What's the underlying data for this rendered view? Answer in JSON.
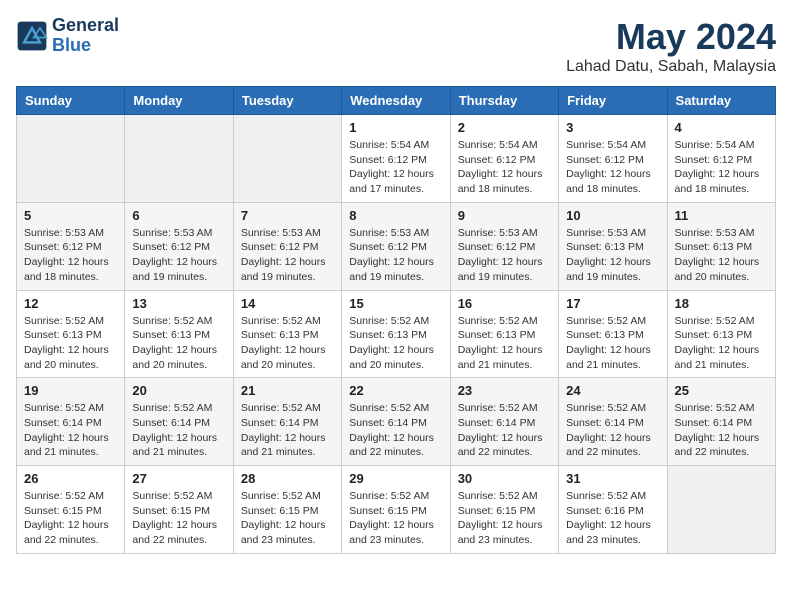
{
  "logo": {
    "line1": "General",
    "line2": "Blue"
  },
  "title": "May 2024",
  "subtitle": "Lahad Datu, Sabah, Malaysia",
  "days_header": [
    "Sunday",
    "Monday",
    "Tuesday",
    "Wednesday",
    "Thursday",
    "Friday",
    "Saturday"
  ],
  "weeks": [
    [
      {
        "day": "",
        "info": ""
      },
      {
        "day": "",
        "info": ""
      },
      {
        "day": "",
        "info": ""
      },
      {
        "day": "1",
        "info": "Sunrise: 5:54 AM\nSunset: 6:12 PM\nDaylight: 12 hours\nand 17 minutes."
      },
      {
        "day": "2",
        "info": "Sunrise: 5:54 AM\nSunset: 6:12 PM\nDaylight: 12 hours\nand 18 minutes."
      },
      {
        "day": "3",
        "info": "Sunrise: 5:54 AM\nSunset: 6:12 PM\nDaylight: 12 hours\nand 18 minutes."
      },
      {
        "day": "4",
        "info": "Sunrise: 5:54 AM\nSunset: 6:12 PM\nDaylight: 12 hours\nand 18 minutes."
      }
    ],
    [
      {
        "day": "5",
        "info": "Sunrise: 5:53 AM\nSunset: 6:12 PM\nDaylight: 12 hours\nand 18 minutes."
      },
      {
        "day": "6",
        "info": "Sunrise: 5:53 AM\nSunset: 6:12 PM\nDaylight: 12 hours\nand 19 minutes."
      },
      {
        "day": "7",
        "info": "Sunrise: 5:53 AM\nSunset: 6:12 PM\nDaylight: 12 hours\nand 19 minutes."
      },
      {
        "day": "8",
        "info": "Sunrise: 5:53 AM\nSunset: 6:12 PM\nDaylight: 12 hours\nand 19 minutes."
      },
      {
        "day": "9",
        "info": "Sunrise: 5:53 AM\nSunset: 6:12 PM\nDaylight: 12 hours\nand 19 minutes."
      },
      {
        "day": "10",
        "info": "Sunrise: 5:53 AM\nSunset: 6:13 PM\nDaylight: 12 hours\nand 19 minutes."
      },
      {
        "day": "11",
        "info": "Sunrise: 5:53 AM\nSunset: 6:13 PM\nDaylight: 12 hours\nand 20 minutes."
      }
    ],
    [
      {
        "day": "12",
        "info": "Sunrise: 5:52 AM\nSunset: 6:13 PM\nDaylight: 12 hours\nand 20 minutes."
      },
      {
        "day": "13",
        "info": "Sunrise: 5:52 AM\nSunset: 6:13 PM\nDaylight: 12 hours\nand 20 minutes."
      },
      {
        "day": "14",
        "info": "Sunrise: 5:52 AM\nSunset: 6:13 PM\nDaylight: 12 hours\nand 20 minutes."
      },
      {
        "day": "15",
        "info": "Sunrise: 5:52 AM\nSunset: 6:13 PM\nDaylight: 12 hours\nand 20 minutes."
      },
      {
        "day": "16",
        "info": "Sunrise: 5:52 AM\nSunset: 6:13 PM\nDaylight: 12 hours\nand 21 minutes."
      },
      {
        "day": "17",
        "info": "Sunrise: 5:52 AM\nSunset: 6:13 PM\nDaylight: 12 hours\nand 21 minutes."
      },
      {
        "day": "18",
        "info": "Sunrise: 5:52 AM\nSunset: 6:13 PM\nDaylight: 12 hours\nand 21 minutes."
      }
    ],
    [
      {
        "day": "19",
        "info": "Sunrise: 5:52 AM\nSunset: 6:14 PM\nDaylight: 12 hours\nand 21 minutes."
      },
      {
        "day": "20",
        "info": "Sunrise: 5:52 AM\nSunset: 6:14 PM\nDaylight: 12 hours\nand 21 minutes."
      },
      {
        "day": "21",
        "info": "Sunrise: 5:52 AM\nSunset: 6:14 PM\nDaylight: 12 hours\nand 21 minutes."
      },
      {
        "day": "22",
        "info": "Sunrise: 5:52 AM\nSunset: 6:14 PM\nDaylight: 12 hours\nand 22 minutes."
      },
      {
        "day": "23",
        "info": "Sunrise: 5:52 AM\nSunset: 6:14 PM\nDaylight: 12 hours\nand 22 minutes."
      },
      {
        "day": "24",
        "info": "Sunrise: 5:52 AM\nSunset: 6:14 PM\nDaylight: 12 hours\nand 22 minutes."
      },
      {
        "day": "25",
        "info": "Sunrise: 5:52 AM\nSunset: 6:14 PM\nDaylight: 12 hours\nand 22 minutes."
      }
    ],
    [
      {
        "day": "26",
        "info": "Sunrise: 5:52 AM\nSunset: 6:15 PM\nDaylight: 12 hours\nand 22 minutes."
      },
      {
        "day": "27",
        "info": "Sunrise: 5:52 AM\nSunset: 6:15 PM\nDaylight: 12 hours\nand 22 minutes."
      },
      {
        "day": "28",
        "info": "Sunrise: 5:52 AM\nSunset: 6:15 PM\nDaylight: 12 hours\nand 23 minutes."
      },
      {
        "day": "29",
        "info": "Sunrise: 5:52 AM\nSunset: 6:15 PM\nDaylight: 12 hours\nand 23 minutes."
      },
      {
        "day": "30",
        "info": "Sunrise: 5:52 AM\nSunset: 6:15 PM\nDaylight: 12 hours\nand 23 minutes."
      },
      {
        "day": "31",
        "info": "Sunrise: 5:52 AM\nSunset: 6:16 PM\nDaylight: 12 hours\nand 23 minutes."
      },
      {
        "day": "",
        "info": ""
      }
    ]
  ]
}
